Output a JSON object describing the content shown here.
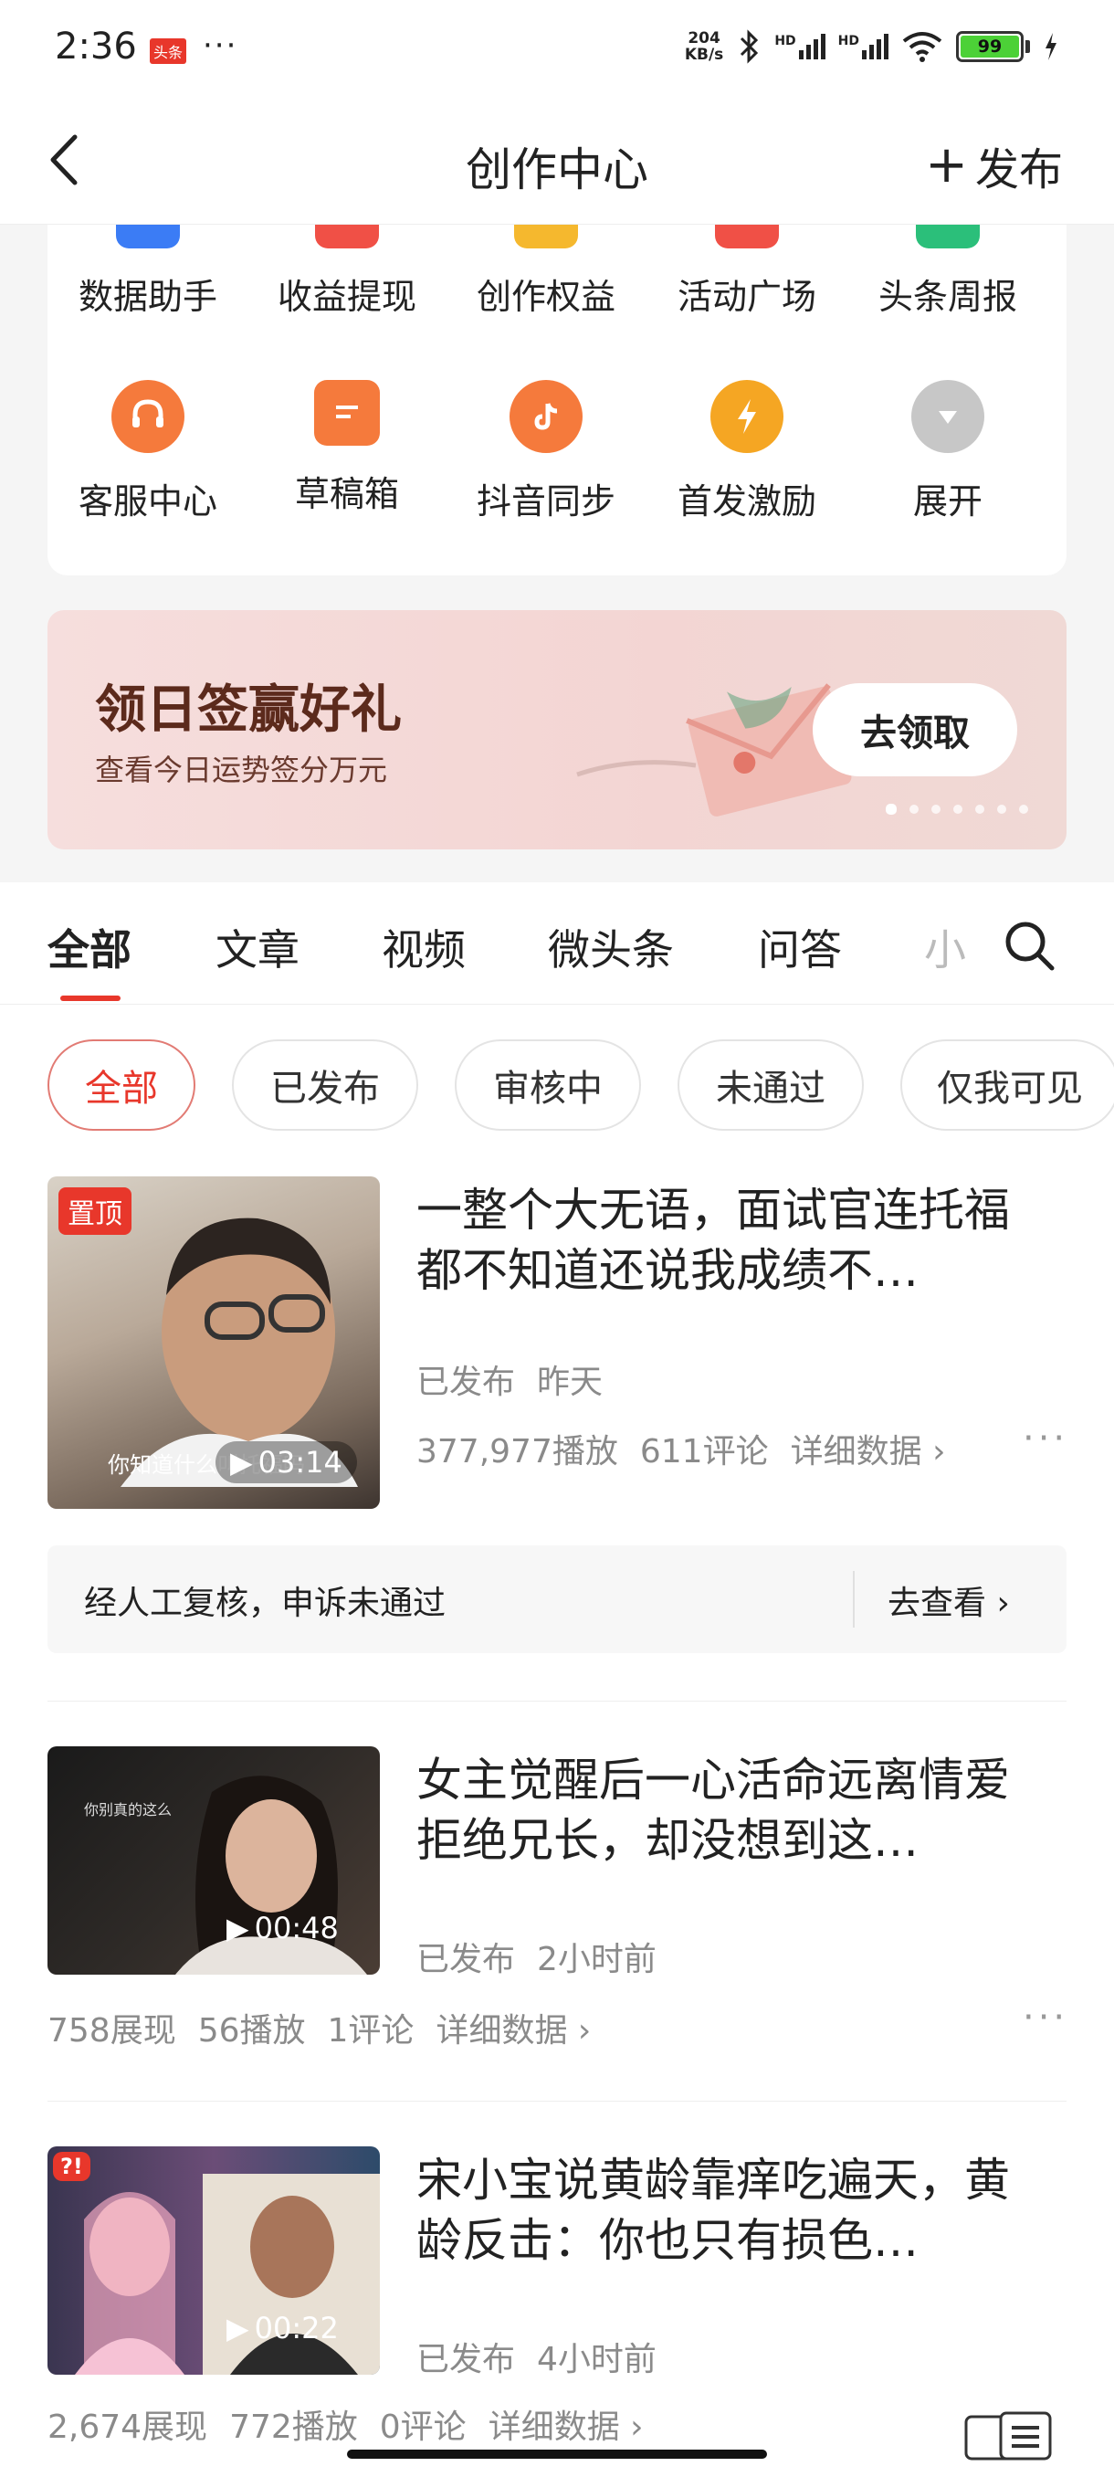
{
  "status_bar": {
    "time": "2:36",
    "app_badge": "头条",
    "more": "···",
    "net_speed_value": "204",
    "net_speed_unit": "KB/s",
    "hd1": "HD",
    "hd2": "HD",
    "battery": "99"
  },
  "nav": {
    "title": "创作中心",
    "publish_label": "发布",
    "publish_prefix": "+"
  },
  "grid": {
    "row1": [
      {
        "label": "数据助手",
        "icon": "data-assistant-icon",
        "color": "#3b7cf5"
      },
      {
        "label": "收益提现",
        "icon": "withdraw-icon",
        "color": "#f05046"
      },
      {
        "label": "创作权益",
        "icon": "rights-icon",
        "color": "#f5b82e"
      },
      {
        "label": "活动广场",
        "icon": "activity-icon",
        "color": "#f05046"
      },
      {
        "label": "头条周报",
        "icon": "weekly-report-icon",
        "color": "#2bbf7a"
      }
    ],
    "row2": [
      {
        "label": "客服中心",
        "icon": "headset-icon",
        "color": "#f57a3c"
      },
      {
        "label": "草稿箱",
        "icon": "draft-icon",
        "color": "#f57a3c"
      },
      {
        "label": "抖音同步",
        "icon": "douyin-icon",
        "color": "#f57a3c"
      },
      {
        "label": "首发激励",
        "icon": "lightning-icon",
        "color": "#f5a623"
      },
      {
        "label": "展开",
        "icon": "expand-icon",
        "color": "#c7c7c7"
      }
    ]
  },
  "banner": {
    "title": "领日签赢好礼",
    "subtitle": "查看今日运势签分万元",
    "button": "去领取",
    "dots": 7
  },
  "tabs": {
    "items": [
      "全部",
      "文章",
      "视频",
      "微头条",
      "问答",
      "小"
    ],
    "active": "全部"
  },
  "filters": {
    "items": [
      "全部",
      "已发布",
      "审核中",
      "未通过",
      "仅我可见"
    ],
    "active": "全部"
  },
  "items": [
    {
      "pinned": "置顶",
      "title": "一整个大无语，面试官连托福都不知道还说我成绩不…",
      "duration": "03:14",
      "thumb_caption": "你知道什么叫托福吗",
      "status": "已发布",
      "time": "昨天",
      "plays": "377,977播放",
      "comments": "611评论",
      "detail": "详细数据",
      "notice": "经人工复核，申诉未通过",
      "notice_link": "去查看"
    },
    {
      "title": "女主觉醒后一心活命远离情爱拒绝兄长，却没想到这…",
      "duration": "00:48",
      "thumb_caption": "你别真的这么",
      "status": "已发布",
      "time": "2小时前",
      "impressions": "758展现",
      "plays": "56播放",
      "comments": "1评论",
      "detail": "详细数据"
    },
    {
      "title": "宋小宝说黄龄靠痒吃遍天，黄龄反击：你也只有损色…",
      "duration": "00:22",
      "status": "已发布",
      "time": "4小时前",
      "impressions": "2,674展现",
      "plays": "772播放",
      "comments": "0评论",
      "detail": "详细数据"
    }
  ],
  "colors": {
    "accent": "#e8372b",
    "muted": "#8a8a8a"
  }
}
